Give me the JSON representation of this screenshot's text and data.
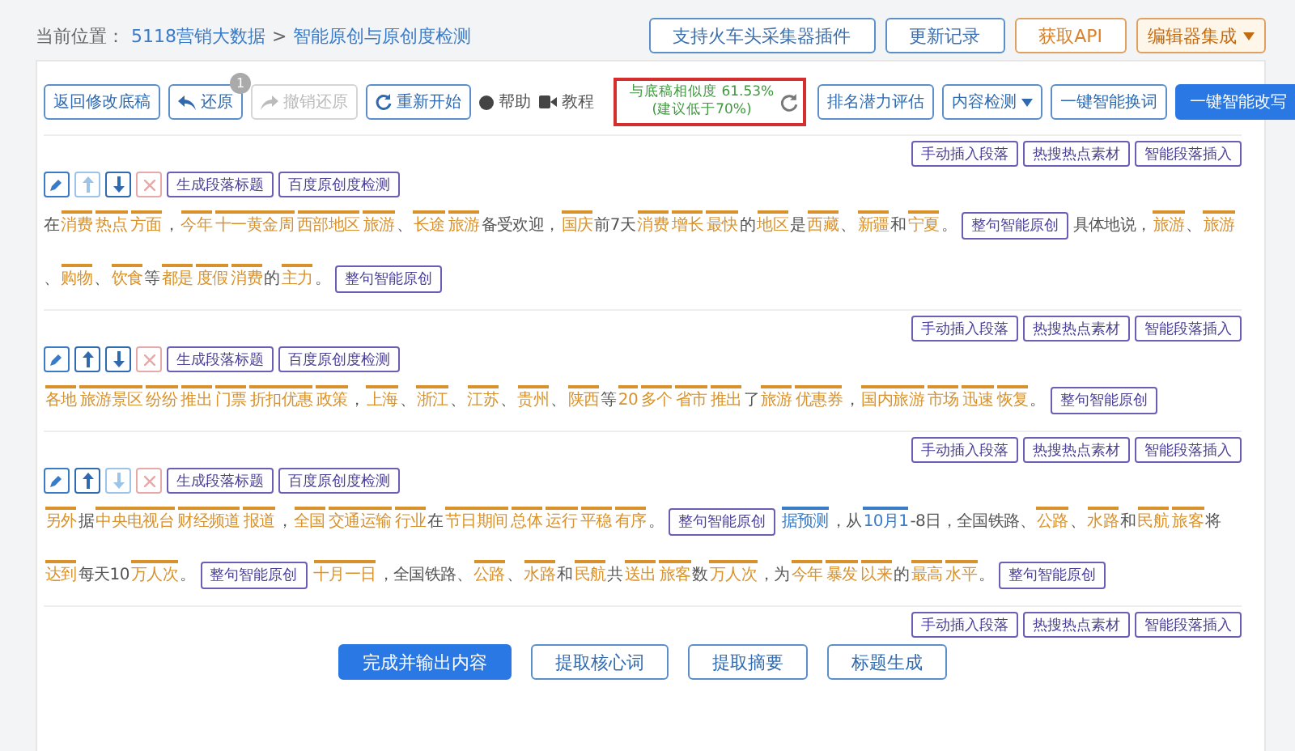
{
  "breadcrumb": {
    "label": "当前位置：",
    "links": [
      "5118营销大数据",
      "智能原创与原创度检测"
    ],
    "separator": ">"
  },
  "top_buttons": [
    {
      "label": "支持火车头采集器插件",
      "kind": "outline"
    },
    {
      "label": "更新记录",
      "kind": "outline"
    },
    {
      "label": "获取API",
      "kind": "warn"
    },
    {
      "label": "编辑器集成",
      "kind": "warnmenu"
    }
  ],
  "toolbar": {
    "back": "返回修改底稿",
    "undo": {
      "label": "还原",
      "badge": "1",
      "disabled": false
    },
    "redo": {
      "label": "撤销还原",
      "disabled": true
    },
    "restart": "重新开始",
    "help": "帮助",
    "tutorial": "教程",
    "similarity": {
      "line1": "与底稿相似度 61.53%",
      "line2": "(建议低于70%)"
    },
    "actions": [
      {
        "label": "排名潜力评估",
        "kind": "outline"
      },
      {
        "label": "内容检测",
        "kind": "menu"
      },
      {
        "label": "一键智能换词",
        "kind": "outline"
      },
      {
        "label": "一键智能改写",
        "kind": "primary"
      }
    ]
  },
  "insert_buttons": [
    "手动插入段落",
    "热搜热点素材",
    "智能段落插入"
  ],
  "paragraphs": [
    {
      "up_disabled": true,
      "down_disabled": false,
      "buttons": [
        "生成段落标题",
        "百度原创度检测"
      ],
      "insert_buttons": [
        "手动插入段落",
        "热搜热点素材",
        "智能段落插入"
      ],
      "segments": [
        {
          "kind": "plain",
          "text": "在"
        },
        {
          "kind": "word",
          "text": "消费"
        },
        {
          "kind": "word",
          "text": "热点"
        },
        {
          "kind": "word",
          "text": "方面"
        },
        {
          "kind": "plain",
          "text": "，"
        },
        {
          "kind": "word",
          "text": "今年"
        },
        {
          "kind": "word",
          "text": "十一黄金周"
        },
        {
          "kind": "word",
          "text": "西部地区"
        },
        {
          "kind": "word",
          "text": "旅游"
        },
        {
          "kind": "plain",
          "text": "、"
        },
        {
          "kind": "word",
          "text": "长途"
        },
        {
          "kind": "word",
          "text": "旅游"
        },
        {
          "kind": "plain",
          "text": "备受欢迎，"
        },
        {
          "kind": "word",
          "text": "国庆"
        },
        {
          "kind": "plain",
          "text": "前7天"
        },
        {
          "kind": "word",
          "text": "消费"
        },
        {
          "kind": "word",
          "text": "增长"
        },
        {
          "kind": "word",
          "text": "最快"
        },
        {
          "kind": "plain",
          "text": "的"
        },
        {
          "kind": "word",
          "text": "地区"
        },
        {
          "kind": "plain",
          "text": "是"
        },
        {
          "kind": "word",
          "text": "西藏"
        },
        {
          "kind": "plain",
          "text": "、"
        },
        {
          "kind": "word",
          "text": "新疆"
        },
        {
          "kind": "plain",
          "text": "和"
        },
        {
          "kind": "word",
          "text": "宁夏"
        },
        {
          "kind": "plain",
          "text": "。"
        },
        {
          "kind": "action",
          "text": "整句智能原创"
        },
        {
          "kind": "plain",
          "text": "具体地说，"
        },
        {
          "kind": "word",
          "text": "旅游"
        },
        {
          "kind": "plain",
          "text": "、"
        },
        {
          "kind": "word",
          "text": "旅游"
        },
        {
          "kind": "plain",
          "text": "、"
        },
        {
          "kind": "word",
          "text": "购物"
        },
        {
          "kind": "plain",
          "text": "、"
        },
        {
          "kind": "word",
          "text": "饮食"
        },
        {
          "kind": "plain",
          "text": "等"
        },
        {
          "kind": "word",
          "text": "都是"
        },
        {
          "kind": "word",
          "text": "度假"
        },
        {
          "kind": "word",
          "text": "消费"
        },
        {
          "kind": "plain",
          "text": "的"
        },
        {
          "kind": "word",
          "text": "主力"
        },
        {
          "kind": "plain",
          "text": "。"
        },
        {
          "kind": "action",
          "text": "整句智能原创"
        }
      ]
    },
    {
      "up_disabled": false,
      "down_disabled": false,
      "buttons": [
        "生成段落标题",
        "百度原创度检测"
      ],
      "insert_buttons": [
        "手动插入段落",
        "热搜热点素材",
        "智能段落插入"
      ],
      "segments": [
        {
          "kind": "word",
          "text": "各地"
        },
        {
          "kind": "word",
          "text": "旅游景区"
        },
        {
          "kind": "word",
          "text": "纷纷"
        },
        {
          "kind": "word",
          "text": "推出"
        },
        {
          "kind": "word",
          "text": "门票"
        },
        {
          "kind": "word",
          "text": "折扣优惠"
        },
        {
          "kind": "word",
          "text": "政策"
        },
        {
          "kind": "plain",
          "text": "，"
        },
        {
          "kind": "word",
          "text": "上海"
        },
        {
          "kind": "plain",
          "text": "、"
        },
        {
          "kind": "word",
          "text": "浙江"
        },
        {
          "kind": "plain",
          "text": "、"
        },
        {
          "kind": "word",
          "text": "江苏"
        },
        {
          "kind": "plain",
          "text": "、"
        },
        {
          "kind": "word",
          "text": "贵州"
        },
        {
          "kind": "plain",
          "text": "、"
        },
        {
          "kind": "word",
          "text": "陕西"
        },
        {
          "kind": "plain",
          "text": "等"
        },
        {
          "kind": "word",
          "text": "20"
        },
        {
          "kind": "word",
          "text": "多个"
        },
        {
          "kind": "word",
          "text": "省市"
        },
        {
          "kind": "word",
          "text": "推出"
        },
        {
          "kind": "plain",
          "text": "了"
        },
        {
          "kind": "word",
          "text": "旅游"
        },
        {
          "kind": "word",
          "text": "优惠券"
        },
        {
          "kind": "plain",
          "text": "，"
        },
        {
          "kind": "word",
          "text": "国内旅游"
        },
        {
          "kind": "word",
          "text": "市场"
        },
        {
          "kind": "word",
          "text": "迅速"
        },
        {
          "kind": "word",
          "text": "恢复"
        },
        {
          "kind": "plain",
          "text": "。"
        },
        {
          "kind": "action",
          "text": "整句智能原创"
        }
      ]
    },
    {
      "up_disabled": false,
      "down_disabled": true,
      "buttons": [
        "生成段落标题",
        "百度原创度检测"
      ],
      "insert_buttons": [
        "手动插入段落",
        "热搜热点素材",
        "智能段落插入"
      ],
      "segments": [
        {
          "kind": "word",
          "text": "另外"
        },
        {
          "kind": "plain",
          "text": "据"
        },
        {
          "kind": "word",
          "text": "中央电视台"
        },
        {
          "kind": "word",
          "text": "财经频道"
        },
        {
          "kind": "word",
          "text": "报道"
        },
        {
          "kind": "plain",
          "text": "，"
        },
        {
          "kind": "word",
          "text": "全国"
        },
        {
          "kind": "word",
          "text": "交通运输"
        },
        {
          "kind": "word",
          "text": "行业"
        },
        {
          "kind": "plain",
          "text": "在"
        },
        {
          "kind": "word",
          "text": "节日期间"
        },
        {
          "kind": "word",
          "text": "总体"
        },
        {
          "kind": "word",
          "text": "运行"
        },
        {
          "kind": "word",
          "text": "平稳"
        },
        {
          "kind": "word",
          "text": "有序"
        },
        {
          "kind": "plain",
          "text": "。"
        },
        {
          "kind": "action",
          "text": "整句智能原创"
        },
        {
          "kind": "note",
          "text": "据预测"
        },
        {
          "kind": "plain",
          "text": "，从"
        },
        {
          "kind": "note",
          "text": "10月1"
        },
        {
          "kind": "plain",
          "text": "-8日，全国铁路、"
        },
        {
          "kind": "word",
          "text": "公路"
        },
        {
          "kind": "plain",
          "text": "、"
        },
        {
          "kind": "word",
          "text": "水路"
        },
        {
          "kind": "plain",
          "text": "和"
        },
        {
          "kind": "word",
          "text": "民航"
        },
        {
          "kind": "word",
          "text": "旅客"
        },
        {
          "kind": "plain",
          "text": "将"
        },
        {
          "kind": "word",
          "text": "达到"
        },
        {
          "kind": "plain",
          "text": "每天10"
        },
        {
          "kind": "word",
          "text": "万人次"
        },
        {
          "kind": "plain",
          "text": "。"
        },
        {
          "kind": "action",
          "text": "整句智能原创"
        },
        {
          "kind": "word",
          "text": "十月一日"
        },
        {
          "kind": "plain",
          "text": "，全国铁路、"
        },
        {
          "kind": "word",
          "text": "公路"
        },
        {
          "kind": "plain",
          "text": "、"
        },
        {
          "kind": "word",
          "text": "水路"
        },
        {
          "kind": "plain",
          "text": "和"
        },
        {
          "kind": "word",
          "text": "民航"
        },
        {
          "kind": "plain",
          "text": "共"
        },
        {
          "kind": "word",
          "text": "送出"
        },
        {
          "kind": "word",
          "text": "旅客"
        },
        {
          "kind": "plain",
          "text": "数"
        },
        {
          "kind": "word",
          "text": "万人次"
        },
        {
          "kind": "plain",
          "text": "，为"
        },
        {
          "kind": "word",
          "text": "今年"
        },
        {
          "kind": "word",
          "text": "暴发"
        },
        {
          "kind": "word",
          "text": "以来"
        },
        {
          "kind": "plain",
          "text": "的"
        },
        {
          "kind": "word",
          "text": "最高"
        },
        {
          "kind": "word",
          "text": "水平"
        },
        {
          "kind": "plain",
          "text": "。"
        },
        {
          "kind": "action",
          "text": "整句智能原创"
        }
      ]
    }
  ],
  "bottom_buttons": [
    {
      "label": "完成并输出内容",
      "kind": "primary"
    },
    {
      "label": "提取核心词",
      "kind": "outline"
    },
    {
      "label": "提取摘要",
      "kind": "outline"
    },
    {
      "label": "标题生成",
      "kind": "outline"
    }
  ]
}
